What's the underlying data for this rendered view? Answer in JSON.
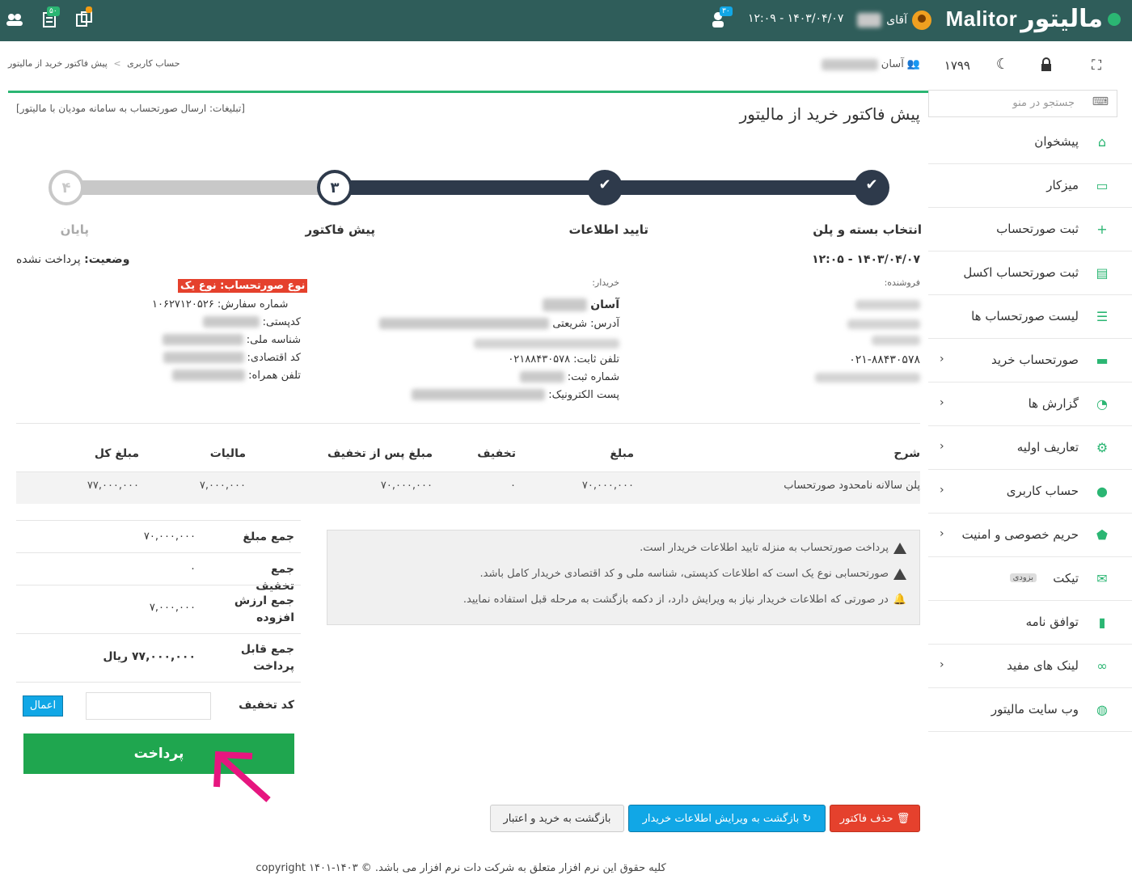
{
  "topbar": {
    "logo_en": "Malitor",
    "logo_fa": "مالیتور",
    "user_prefix": "آقای",
    "datetime": "۱۴۰۳/۰۴/۰۷ - ۱۲:۰۹",
    "badge_invoices": "۵۰",
    "badge_notif": "۳۰"
  },
  "sidebar": {
    "tools": {
      "credit": "۱۷۹۹"
    },
    "search_placeholder": "جستجو در منو",
    "items": [
      {
        "label": "پیشخوان",
        "icon": "home-icon",
        "expandable": false
      },
      {
        "label": "میزکار",
        "icon": "monitor-icon",
        "expandable": false
      },
      {
        "label": "ثبت صورتحساب",
        "icon": "plus-icon",
        "expandable": false
      },
      {
        "label": "ثبت صورتحساب اکسل",
        "icon": "excel-icon",
        "expandable": false
      },
      {
        "label": "لیست صورتحساب ها",
        "icon": "list-icon",
        "expandable": false
      },
      {
        "label": "صورتحساب خرید",
        "icon": "money-icon",
        "expandable": true
      },
      {
        "label": "گزارش ها",
        "icon": "chart-icon",
        "expandable": true
      },
      {
        "label": "تعاریف اولیه",
        "icon": "gears-icon",
        "expandable": true
      },
      {
        "label": "حساب کاربری",
        "icon": "user-icon",
        "expandable": true
      },
      {
        "label": "حریم خصوصی و امنیت",
        "icon": "shield-icon",
        "expandable": true
      },
      {
        "label": "تیکت",
        "icon": "envelope-icon",
        "expandable": false,
        "badge": "بزودی"
      },
      {
        "label": "توافق نامه",
        "icon": "document-icon",
        "expandable": false
      },
      {
        "label": "لینک های مفید",
        "icon": "glasses-icon",
        "expandable": true
      },
      {
        "label": "وب سایت مالیتور",
        "icon": "globe-icon",
        "expandable": false
      }
    ]
  },
  "breadcrumb": {
    "parent": "حساب کاربری",
    "sep": ">",
    "current": "پیش فاکتور خرید از مالیتور"
  },
  "project": {
    "name": "آسان"
  },
  "page": {
    "title": "پیش فاکتور خرید از مالیتور",
    "ad": "[تبلیغات: ارسال صورتحساب به سامانه مودیان با مالیتور]"
  },
  "stepper": {
    "steps": [
      {
        "label": "انتخاب بسته و پلن",
        "state": "done"
      },
      {
        "label": "تایید اطلاعات",
        "state": "done"
      },
      {
        "label": "پیش فاکتور",
        "state": "current",
        "number": "۳"
      },
      {
        "label": "پایان",
        "state": "pending",
        "number": "۴"
      }
    ]
  },
  "invoice": {
    "date": "۱۴۰۳/۰۴/۰۷ - ۱۲:۰۵",
    "status_label": "وضعیت:",
    "status_value": "پرداخت نشده",
    "seller_label": "فروشنده:",
    "seller_phone": "۰۲۱-۸۸۴۳۰۵۷۸",
    "buyer_label": "خریدار:",
    "buyer_name": "آسان",
    "buyer_address_label": "آدرس:",
    "buyer_address": "شریعتی",
    "buyer_phone_label": "تلفن ثابت:",
    "buyer_phone": "۰۲۱۸۸۴۳۰۵۷۸",
    "buyer_reg_label": "شماره ثبت:",
    "buyer_email_label": "پست الکترونیک:",
    "type_badge": "نوع صورتحساب: نوع یک",
    "order_label": "شماره سفارش:",
    "order_no": "۱۰۶۲۷۱۲۰۵۲۶",
    "postal_label": "کدپستی:",
    "national_label": "شناسه ملی:",
    "economic_label": "کد اقتصادی:",
    "mobile_label": "تلفن همراه:"
  },
  "table": {
    "headers": [
      "شرح",
      "مبلغ",
      "تخفیف",
      "مبلغ پس از تخفیف",
      "مالیات",
      "مبلغ کل"
    ],
    "rows": [
      [
        "پلن سالانه نامحدود صورتحساب",
        "۷۰,۰۰۰,۰۰۰",
        "۰",
        "۷۰,۰۰۰,۰۰۰",
        "۷,۰۰۰,۰۰۰",
        "۷۷,۰۰۰,۰۰۰"
      ]
    ]
  },
  "totals": {
    "sum_label": "جمع مبلغ",
    "sum": "۷۰,۰۰۰,۰۰۰",
    "discount_label": "جمع تخفیف",
    "discount": "۰",
    "vat_label": "جمع ارزش افزوده",
    "vat": "۷,۰۰۰,۰۰۰",
    "payable_label": "جمع قابل پرداخت",
    "payable": "۷۷,۰۰۰,۰۰۰ ریال",
    "coupon_label": "کد تخفیف",
    "coupon_value": "",
    "apply": "اعمال",
    "pay": "پرداخت"
  },
  "notes": [
    "پرداخت صورتحساب به منزله تایید اطلاعات خریدار است.",
    "صورتحسابی نوع یک است که اطلاعات کدپستی، شناسه ملی و کد اقتصادی خریدار کامل باشد.",
    "در صورتی که اطلاعات خریدار نیاز به ویرایش دارد، از دکمه بازگشت به مرحله قبل استفاده نمایید."
  ],
  "actions": {
    "delete": "حذف فاکتور",
    "edit_back": "بازگشت به ویرایش اطلاعات خریدار",
    "back_credit": "بازگشت به خرید و اعتبار"
  },
  "footer": "کلیه حقوق این نرم افزار متعلق به شرکت دات نرم افزار می باشد. © copyright ۱۴۰۱-۱۴۰۳",
  "colors": {
    "primary": "#2f5d5a",
    "accent": "#2bb673",
    "danger": "#e5412d",
    "info": "#11a7e6",
    "step_dark": "#2e3a4b"
  }
}
